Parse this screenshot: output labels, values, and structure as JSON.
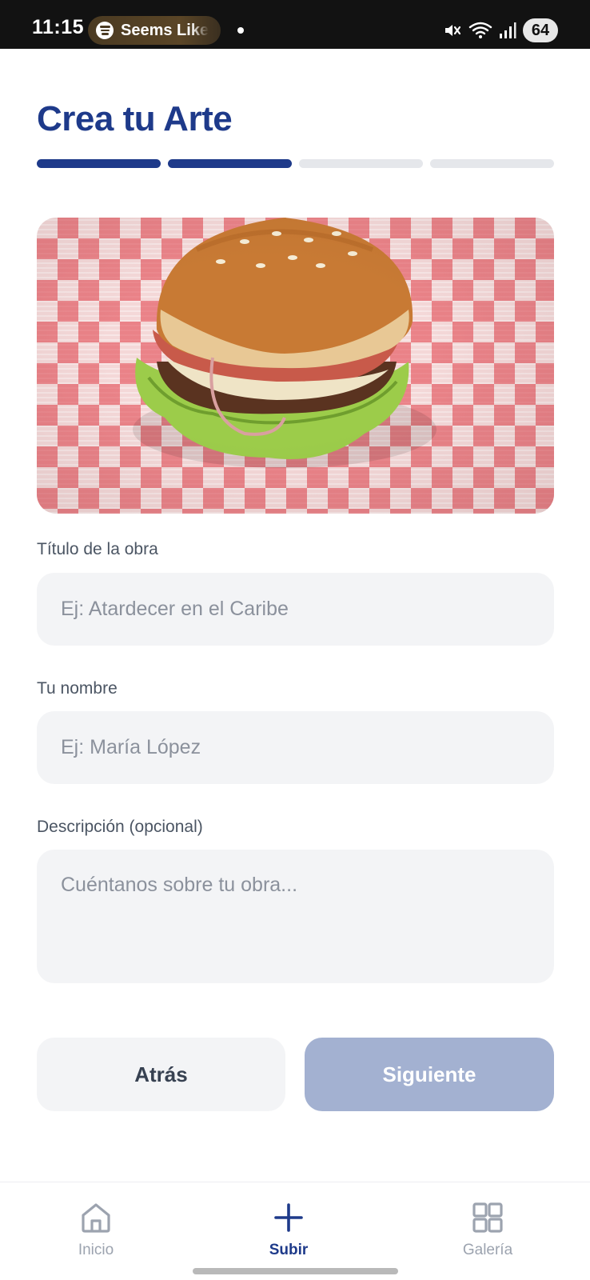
{
  "status_bar": {
    "time": "11:15",
    "media_text": "Seems Like",
    "battery": "64",
    "icons": [
      "spotify-icon",
      "mute-icon",
      "wifi-icon",
      "signal-icon",
      "battery-icon"
    ]
  },
  "header": {
    "title": "Crea tu Arte"
  },
  "progress": {
    "total_steps": 4,
    "completed_steps": 2
  },
  "form": {
    "title_label": "Título de la obra",
    "title_placeholder": "Ej: Atardecer en el Caribe",
    "title_value": "",
    "name_label": "Tu nombre",
    "name_placeholder": "Ej: María López",
    "name_value": "",
    "description_label": "Descripción (opcional)",
    "description_placeholder": "Cuéntanos sobre tu obra...",
    "description_value": ""
  },
  "actions": {
    "back_label": "Atrás",
    "next_label": "Siguiente"
  },
  "bottom_nav": {
    "items": [
      {
        "label": "Inicio",
        "icon": "home-icon",
        "active": false
      },
      {
        "label": "Subir",
        "icon": "plus-icon",
        "active": true
      },
      {
        "label": "Galería",
        "icon": "grid-icon",
        "active": false
      }
    ]
  },
  "colors": {
    "primary": "#1e3a8a",
    "primary_disabled": "#a3b1d1",
    "field_bg": "#f3f4f6",
    "muted_text": "#9ca3af",
    "status_bar_bg": "#121212"
  }
}
